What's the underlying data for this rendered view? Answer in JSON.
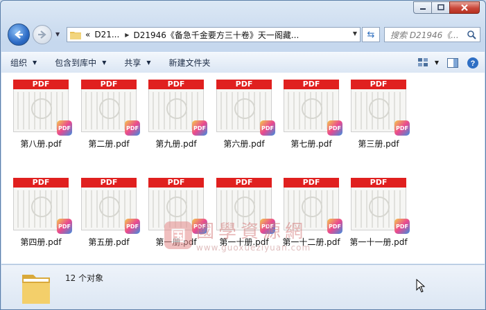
{
  "window": {
    "minimize_icon": "minimize-icon",
    "maximize_icon": "maximize-icon",
    "close_icon": "close-icon"
  },
  "address": {
    "overflow": "«",
    "crumbs": [
      "D21...",
      "D21946《备急千金要方三十卷》天一阁藏..."
    ],
    "search_placeholder": "搜索 D21946《..."
  },
  "toolbar": {
    "organize": "组织",
    "include_library": "包含到库中",
    "share": "共享",
    "new_folder": "新建文件夹"
  },
  "files": [
    {
      "name": "第八册.pdf"
    },
    {
      "name": "第二册.pdf"
    },
    {
      "name": "第九册.pdf"
    },
    {
      "name": "第六册.pdf"
    },
    {
      "name": "第七册.pdf"
    },
    {
      "name": "第三册.pdf"
    },
    {
      "name": "第四册.pdf"
    },
    {
      "name": "第五册.pdf"
    },
    {
      "name": "第一册.pdf"
    },
    {
      "name": "第一十册.pdf"
    },
    {
      "name": "第一十二册.pdf"
    },
    {
      "name": "第一十一册.pdf"
    }
  ],
  "thumb_label": "PDF",
  "badge_label": "PDF",
  "watermark": {
    "logo": "国",
    "cn": "國學資源網",
    "url": "www.guoxueziyuan.com"
  },
  "status": {
    "count": "12 个对象"
  },
  "colors": {
    "pdf_band": "#e0201f",
    "toolbar_bg": "#dbe6f4",
    "close_button": "#c9473a"
  }
}
